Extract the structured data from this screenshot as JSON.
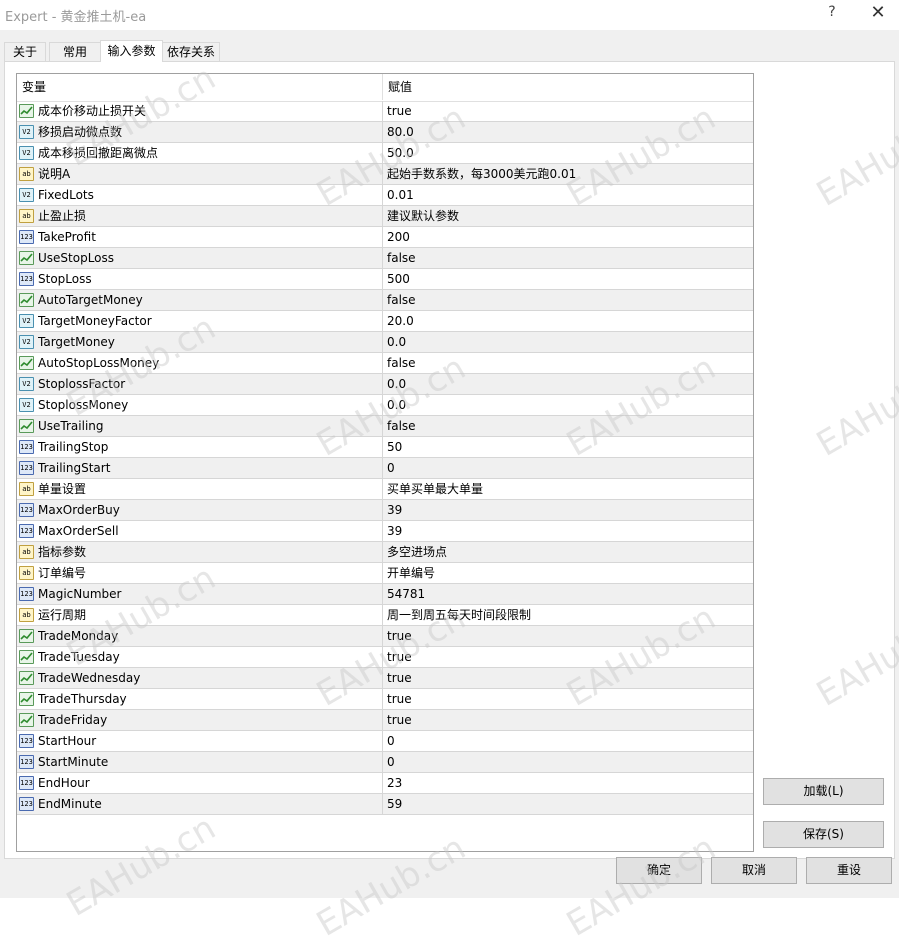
{
  "window": {
    "title": "Expert - 黄金推土机-ea",
    "help_glyph": "?",
    "close_glyph": "✕"
  },
  "tabs": [
    {
      "label": "关于"
    },
    {
      "label": "常用"
    },
    {
      "label": "输入参数"
    },
    {
      "label": "依存关系"
    }
  ],
  "active_tab": "输入参数",
  "grid": {
    "headers": {
      "variable": "变量",
      "value": "赋值"
    },
    "rows": [
      {
        "type": "bool",
        "name": "成本价移动止损开关",
        "value": "true"
      },
      {
        "type": "double",
        "name": "移损启动微点数",
        "value": "80.0"
      },
      {
        "type": "double",
        "name": "成本移损回撤距离微点",
        "value": "50.0"
      },
      {
        "type": "string",
        "name": "说明A",
        "value": "起始手数系数，每3000美元跑0.01"
      },
      {
        "type": "double",
        "name": "FixedLots",
        "value": "0.01"
      },
      {
        "type": "string",
        "name": "止盈止损",
        "value": "建议默认参数"
      },
      {
        "type": "int",
        "name": "TakeProfit",
        "value": "200"
      },
      {
        "type": "bool",
        "name": "UseStopLoss",
        "value": "false"
      },
      {
        "type": "int",
        "name": "StopLoss",
        "value": "500"
      },
      {
        "type": "bool",
        "name": "AutoTargetMoney",
        "value": "false"
      },
      {
        "type": "double",
        "name": "TargetMoneyFactor",
        "value": "20.0"
      },
      {
        "type": "double",
        "name": "TargetMoney",
        "value": "0.0"
      },
      {
        "type": "bool",
        "name": "AutoStopLossMoney",
        "value": "false"
      },
      {
        "type": "double",
        "name": "StoplossFactor",
        "value": "0.0"
      },
      {
        "type": "double",
        "name": "StoplossMoney",
        "value": "0.0"
      },
      {
        "type": "bool",
        "name": "UseTrailing",
        "value": "false"
      },
      {
        "type": "int",
        "name": "TrailingStop",
        "value": "50"
      },
      {
        "type": "int",
        "name": "TrailingStart",
        "value": "0"
      },
      {
        "type": "string",
        "name": "单量设置",
        "value": "买单买单最大单量"
      },
      {
        "type": "int",
        "name": "MaxOrderBuy",
        "value": "39"
      },
      {
        "type": "int",
        "name": "MaxOrderSell",
        "value": "39"
      },
      {
        "type": "string",
        "name": "指标参数",
        "value": "多空进场点"
      },
      {
        "type": "string",
        "name": "订单编号",
        "value": "开单编号"
      },
      {
        "type": "int",
        "name": "MagicNumber",
        "value": "54781"
      },
      {
        "type": "string",
        "name": "运行周期",
        "value": "周一到周五每天时间段限制"
      },
      {
        "type": "bool",
        "name": "TradeMonday",
        "value": "true"
      },
      {
        "type": "bool",
        "name": "TradeTuesday",
        "value": "true"
      },
      {
        "type": "bool",
        "name": "TradeWednesday",
        "value": "true"
      },
      {
        "type": "bool",
        "name": "TradeThursday",
        "value": "true"
      },
      {
        "type": "bool",
        "name": "TradeFriday",
        "value": "true"
      },
      {
        "type": "int",
        "name": "StartHour",
        "value": "0"
      },
      {
        "type": "int",
        "name": "StartMinute",
        "value": "0"
      },
      {
        "type": "int",
        "name": "EndHour",
        "value": "23"
      },
      {
        "type": "int",
        "name": "EndMinute",
        "value": "59"
      }
    ]
  },
  "icons": {
    "bool": "bool-icon",
    "double": "double-icon",
    "int": "int-icon",
    "string": "string-icon"
  },
  "icon_glyphs": {
    "double": "V2",
    "int": "123",
    "string": "ab"
  },
  "buttons": {
    "load": "加载(L)",
    "save": "保存(S)",
    "ok": "确定",
    "cancel": "取消",
    "reset": "重设"
  },
  "watermark": "EAHub.cn"
}
